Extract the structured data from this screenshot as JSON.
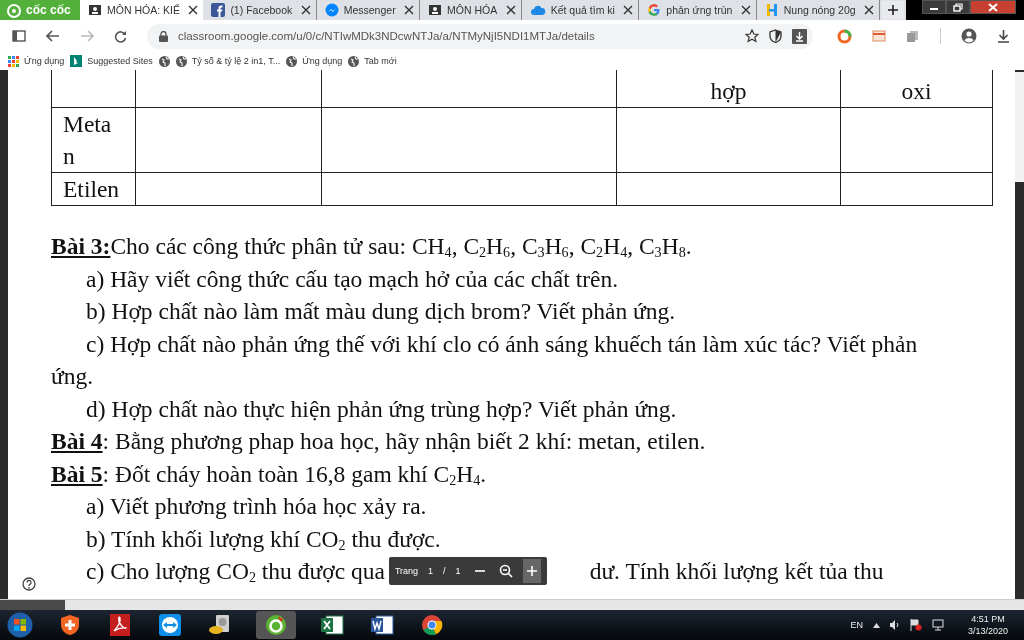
{
  "browser": {
    "logo": "cốc cốc",
    "tabs": [
      {
        "title": "MÔN HÓA: KIẾ",
        "kind": "classroom",
        "selected": true
      },
      {
        "title": "(1) Facebook",
        "kind": "facebook",
        "selected": false
      },
      {
        "title": "Messenger",
        "kind": "messenger",
        "selected": false
      },
      {
        "title": "MÔN HÓA",
        "kind": "classroom",
        "selected": false
      },
      {
        "title": "Kết quả tìm ki",
        "kind": "cloud",
        "selected": false
      },
      {
        "title": "phản ứng trùn",
        "kind": "google",
        "selected": false
      },
      {
        "title": "Nung nóng 20g",
        "kind": "hoidap",
        "selected": false
      }
    ],
    "url": "classroom.google.com/u/0/c/NTIwMDk3NDcwNTJa/a/NTMyNjI5NDI1MTJa/details",
    "bookmarks": [
      {
        "label": "Ứng dụng",
        "kind": "apps"
      },
      {
        "label": "Suggested Sites",
        "kind": "bing"
      },
      {
        "kind": "globe"
      },
      {
        "label": "Tỷ số & tỷ lệ 2 in1, T...",
        "kind": "globe"
      },
      {
        "label": "Ứng dụng",
        "kind": "globe"
      },
      {
        "label": "Tab mới",
        "kind": "globe"
      }
    ]
  },
  "document": {
    "table": {
      "header": {
        "column_4": "hợp",
        "column_5": "oxi"
      },
      "rows": [
        {
          "name": "Metan"
        },
        {
          "name": "Etilen"
        }
      ]
    },
    "lines": [
      {
        "kind": "exercise",
        "label": "Bài 3:",
        "text": "Cho các công thức phân tử sau: CH$_{4}$, C$_{2}$H$_{6}$, C$_{3}$H$_{6}$, C$_{2}$H$_{4}$, C$_{3}$H$_{8}$."
      },
      {
        "kind": "item",
        "text": "a) Hãy viết công thức cấu tạo mạch hở của các chất trên."
      },
      {
        "kind": "item",
        "text": "b) Hợp chất nào làm mất màu dung dịch brom? Viết phản ứng."
      },
      {
        "kind": "item",
        "text": "c) Hợp chất nào phản ứng thế với khí clo có ánh sáng khuếch tán làm xúc tác? Viết phản ứng."
      },
      {
        "kind": "item",
        "text": "d) Hợp chất nào thực hiện phản ứng trùng hợp? Viết phản ứng."
      },
      {
        "kind": "exercise",
        "label": "Bài 4",
        "text": ": Bằng phương phap hoa học, hãy nhận biết 2 khí: metan, etilen."
      },
      {
        "kind": "exercise",
        "label": "Bài 5",
        "text": ": Đốt cháy hoàn toàn 16,8 gam khí C$_{2}$H$_{4}$."
      },
      {
        "kind": "item",
        "text": "a)  Viết phương trình hóa học xảy ra."
      },
      {
        "kind": "item",
        "text": "b)  Tính khối lượng khí CO$_{2}$ thu được."
      },
      {
        "kind": "covered",
        "before": "c)  Cho lượng CO$_{2}$ thu được qua",
        "after": "dư. Tính khối lượng kết tủa thu"
      }
    ],
    "viewer_toolbar": {
      "label": "Trang",
      "page": "1",
      "separator": "/",
      "total": "1"
    }
  },
  "taskbar": {
    "apps": [
      {
        "kind": "start",
        "selected": false
      },
      {
        "kind": "shield",
        "selected": false
      },
      {
        "kind": "pdf",
        "selected": false
      },
      {
        "kind": "teamviewer",
        "selected": false
      },
      {
        "kind": "disk",
        "selected": false
      },
      {
        "kind": "coccoc",
        "selected": true
      },
      {
        "kind": "excel",
        "selected": false
      },
      {
        "kind": "word",
        "selected": false
      },
      {
        "kind": "chrome",
        "selected": false
      }
    ],
    "language": "EN",
    "time": "4:51 PM",
    "date": "3/13/2020"
  }
}
